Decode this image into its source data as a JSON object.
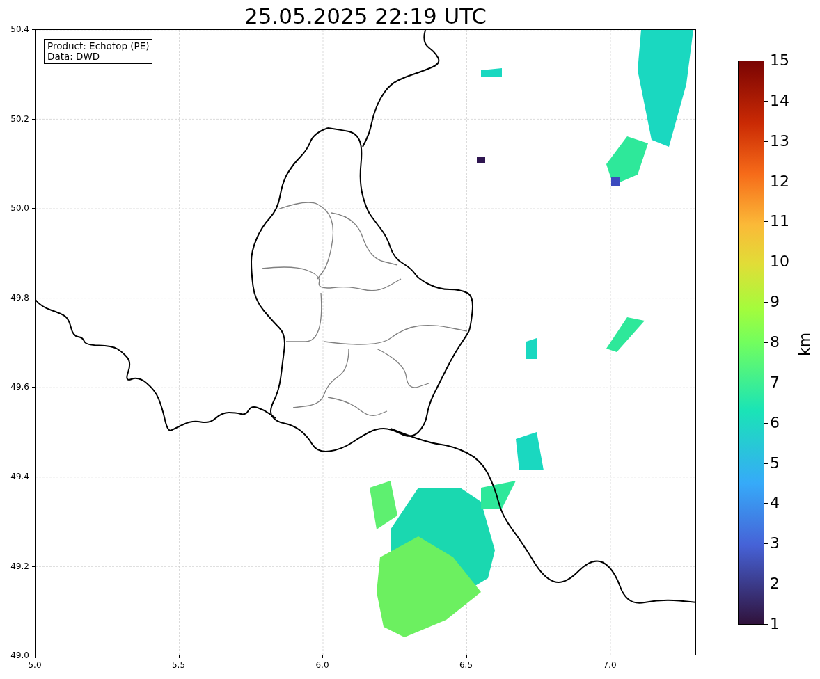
{
  "title": "25.05.2025 22:19 UTC",
  "legend": [
    "Product: Echotop (PE)",
    "Data: DWD"
  ],
  "x_ticks": [
    "5.0",
    "5.5",
    "6.0",
    "6.5",
    "7.0"
  ],
  "y_ticks": [
    "50.4",
    "50.2",
    "50.0",
    "49.8",
    "49.6",
    "49.4",
    "49.2",
    "49.0"
  ],
  "colorbar": {
    "label": "km",
    "ticks": [
      "15",
      "14",
      "13",
      "12",
      "11",
      "10",
      "9",
      "8",
      "7",
      "6",
      "5",
      "4",
      "3",
      "2",
      "1"
    ]
  }
}
